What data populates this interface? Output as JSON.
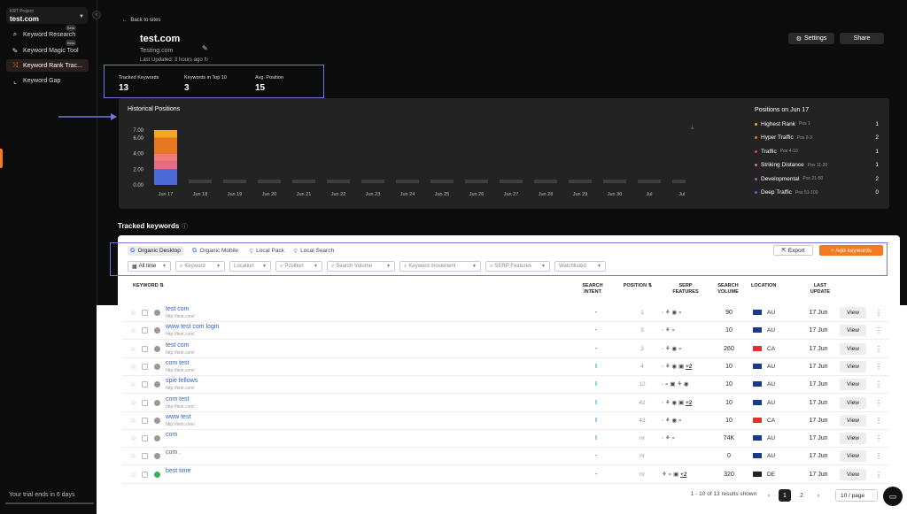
{
  "sidebar": {
    "project_label": "KRT Project",
    "project_name": "test.com",
    "items": [
      {
        "label": "Keyword Research",
        "icon": "search-icon",
        "badge": "Beta"
      },
      {
        "label": "Keyword Magic Tool",
        "icon": "magic-wand-icon",
        "badge": "Beta"
      },
      {
        "label": "Keyword Rank Trac...",
        "icon": "rank-tracker-icon",
        "badge": ""
      },
      {
        "label": "Keyword Gap",
        "icon": "chart-icon",
        "badge": ""
      }
    ],
    "trial_text": "Your trial ends in 6 days"
  },
  "header": {
    "back_label": "Back to sites",
    "title": "test.com",
    "subtitle": "Testing.com",
    "updated": "Last Updated: 3 hours ago",
    "settings_label": "Settings",
    "share_label": "Share"
  },
  "stats": [
    {
      "label": "Tracked Keywords",
      "value": "13"
    },
    {
      "label": "Keywords in Top 10",
      "value": "3"
    },
    {
      "label": "Avg. Position",
      "value": "15"
    }
  ],
  "historical": {
    "title": "Historical Positions",
    "legend_title": "Positions on Jun 17",
    "legend": [
      {
        "name": "Highest Rank",
        "range": "Pos 1",
        "count": "1",
        "color": "#f5a623"
      },
      {
        "name": "Hyper Traffic",
        "range": "Pos 2-3",
        "count": "2",
        "color": "#e87722"
      },
      {
        "name": "Traffic",
        "range": "Pos 4-10",
        "count": "1",
        "color": "#e5484d"
      },
      {
        "name": "Striking Distance",
        "range": "Pos 11-20",
        "count": "1",
        "color": "#e86a85"
      },
      {
        "name": "Developmental",
        "range": "Pos 21-50",
        "count": "2",
        "color": "#a855c7"
      },
      {
        "name": "Deep Traffic",
        "range": "Pos 51-100",
        "count": "0",
        "color": "#4d6bd6"
      }
    ]
  },
  "chart_data": {
    "type": "bar",
    "title": "Historical Positions",
    "categories": [
      "Jun 17",
      "Jun 18",
      "Jun 19",
      "Jun 20",
      "Jun 21",
      "Jun 22",
      "Jun 23",
      "Jun 24",
      "Jun 25",
      "Jun 26",
      "Jun 27",
      "Jun 28",
      "Jun 29",
      "Jun 30",
      "Jul",
      "Jul 2"
    ],
    "yticks": [
      "0.00",
      "2.00",
      "4.00",
      "6.00",
      "7.00"
    ],
    "ylim": [
      0,
      7
    ],
    "series": [
      {
        "name": "Deep Traffic",
        "color": "#4d6bd6",
        "values": [
          2,
          0,
          0,
          0,
          0,
          0,
          0,
          0,
          0,
          0,
          0,
          0,
          0,
          0,
          0,
          0
        ]
      },
      {
        "name": "Developmental",
        "color": "#e86a85",
        "values": [
          1,
          0,
          0,
          0,
          0,
          0,
          0,
          0,
          0,
          0,
          0,
          0,
          0,
          0,
          0,
          0
        ]
      },
      {
        "name": "Striking Distance",
        "color": "#f07a7a",
        "values": [
          1,
          0,
          0,
          0,
          0,
          0,
          0,
          0,
          0,
          0,
          0,
          0,
          0,
          0,
          0,
          0
        ]
      },
      {
        "name": "Traffic",
        "color": "#e87722",
        "values": [
          2,
          0,
          0,
          0,
          0,
          0,
          0,
          0,
          0,
          0,
          0,
          0,
          0,
          0,
          0,
          0
        ]
      },
      {
        "name": "Highest Rank",
        "color": "#f5a623",
        "values": [
          1,
          0,
          0,
          0,
          0,
          0,
          0,
          0,
          0,
          0,
          0,
          0,
          0,
          0,
          0,
          0
        ]
      }
    ]
  },
  "tracked": {
    "title": "Tracked keywords",
    "tabs": [
      "Organic Desktop",
      "Organic Mobile",
      "Local Pack",
      "Local Search"
    ],
    "export_label": "Export",
    "add_label": "+ Add keywords",
    "filters": [
      "All time",
      "Keyword",
      "Location",
      "Position",
      "Search Volume",
      "Keyword movement",
      "SERP Features",
      "Watchlisted"
    ],
    "columns": [
      "KEYWORD",
      "SEARCH INTENT",
      "POSITION",
      "SERP FEATURES",
      "SEARCH VOLUME",
      "LOCATION",
      "LAST UPDATE"
    ],
    "rows": [
      {
        "keyword": "test com",
        "url": "http://test.com/",
        "intent": "-",
        "position": "1",
        "serp": "⋅ ⚘ ◉ ⌕",
        "plus": "",
        "volume": "90",
        "country": "AU",
        "updated": "17 Jun",
        "status": "gray"
      },
      {
        "keyword": "www test com login",
        "url": "http://test.com/",
        "intent": "-",
        "position": "3",
        "serp": "⋅ ⚘ ⌕",
        "plus": "",
        "volume": "10",
        "country": "AU",
        "updated": "17 Jun",
        "status": "gray"
      },
      {
        "keyword": "test com",
        "url": "http://test.com/",
        "intent": "-",
        "position": "3",
        "serp": "⋅ ⚘ ◉ ⌕",
        "plus": "",
        "volume": "260",
        "country": "CA",
        "updated": "17 Jun",
        "status": "gray"
      },
      {
        "keyword": "com test",
        "url": "http://test.com/",
        "intent": "I",
        "position": "4",
        "serp": "⋅ ⚘ ◉ ▣",
        "plus": "+2",
        "volume": "10",
        "country": "AU",
        "updated": "17 Jun",
        "status": "gray"
      },
      {
        "keyword": "spie fellows",
        "url": "http://test.com/",
        "intent": "I",
        "position": "12",
        "serp": "⋅ ⌕ ▣ ⚘ ◉",
        "plus": "",
        "volume": "10",
        "country": "AU",
        "updated": "17 Jun",
        "status": "gray"
      },
      {
        "keyword": "com test",
        "url": "http://test.com/",
        "intent": "I",
        "position": "42",
        "serp": "⋅ ⚘ ◉ ▣",
        "plus": "+2",
        "volume": "10",
        "country": "AU",
        "updated": "17 Jun",
        "status": "gray"
      },
      {
        "keyword": "www test",
        "url": "http://test.com/",
        "intent": "I",
        "position": "43",
        "serp": "⋅ ⚘ ◉ ⌕",
        "plus": "",
        "volume": "10",
        "country": "CA",
        "updated": "17 Jun",
        "status": "gray"
      },
      {
        "keyword": "com",
        "url": "",
        "intent": "I",
        "position": "nr",
        "serp": "⋅ ⚘ ⌕",
        "plus": "",
        "volume": "74K",
        "country": "AU",
        "updated": "17 Jun",
        "status": "gray"
      },
      {
        "keyword": "com .",
        "url": "",
        "intent": "-",
        "position": "nr",
        "serp": "",
        "plus": "",
        "volume": "0",
        "country": "AU",
        "updated": "17 Jun",
        "status": "gray"
      },
      {
        "keyword": "best time",
        "url": "",
        "intent": "-",
        "position": "nr",
        "serp": "⚘ ⌕ ▣",
        "plus": "+2",
        "volume": "320",
        "country": "DE",
        "updated": "17 Jun",
        "status": "green"
      }
    ],
    "view_label": "View",
    "results_text": "1 - 10 of 13 results shown",
    "pages": [
      "1",
      "2"
    ],
    "per_page": "10 / page"
  }
}
